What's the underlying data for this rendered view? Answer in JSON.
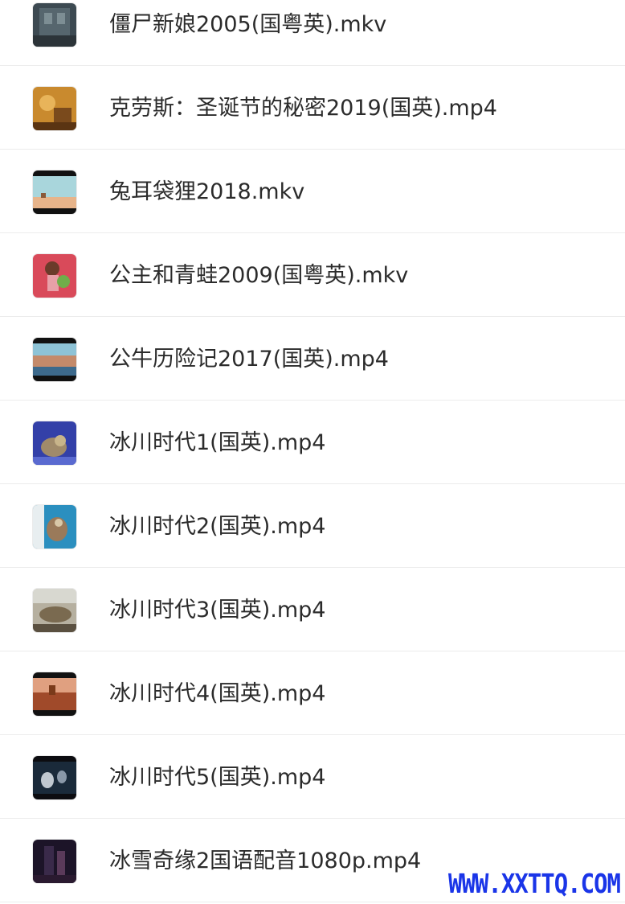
{
  "files": [
    {
      "name": "僵尸新娘2005(国粤英).mkv",
      "thumb_icon": "corpse-bride-thumbnail"
    },
    {
      "name": "克劳斯：圣诞节的秘密2019(国英).mp4",
      "thumb_icon": "klaus-thumbnail"
    },
    {
      "name": "兔耳袋狸2018.mkv",
      "thumb_icon": "bilby-thumbnail"
    },
    {
      "name": "公主和青蛙2009(国粤英).mkv",
      "thumb_icon": "princess-frog-thumbnail"
    },
    {
      "name": "公牛历险记2017(国英).mp4",
      "thumb_icon": "ferdinand-thumbnail"
    },
    {
      "name": "冰川时代1(国英).mp4",
      "thumb_icon": "ice-age-1-thumbnail"
    },
    {
      "name": "冰川时代2(国英).mp4",
      "thumb_icon": "ice-age-2-thumbnail"
    },
    {
      "name": "冰川时代3(国英).mp4",
      "thumb_icon": "ice-age-3-thumbnail"
    },
    {
      "name": "冰川时代4(国英).mp4",
      "thumb_icon": "ice-age-4-thumbnail"
    },
    {
      "name": "冰川时代5(国英).mp4",
      "thumb_icon": "ice-age-5-thumbnail"
    },
    {
      "name": "冰雪奇缘2国语配音1080p.mp4",
      "thumb_icon": "frozen-2-thumbnail"
    }
  ],
  "watermark": "WWW.XXTTQ.COM",
  "colors": {
    "text": "#2b2b2b",
    "divider": "#ececec",
    "watermark": "#1a35e8"
  }
}
